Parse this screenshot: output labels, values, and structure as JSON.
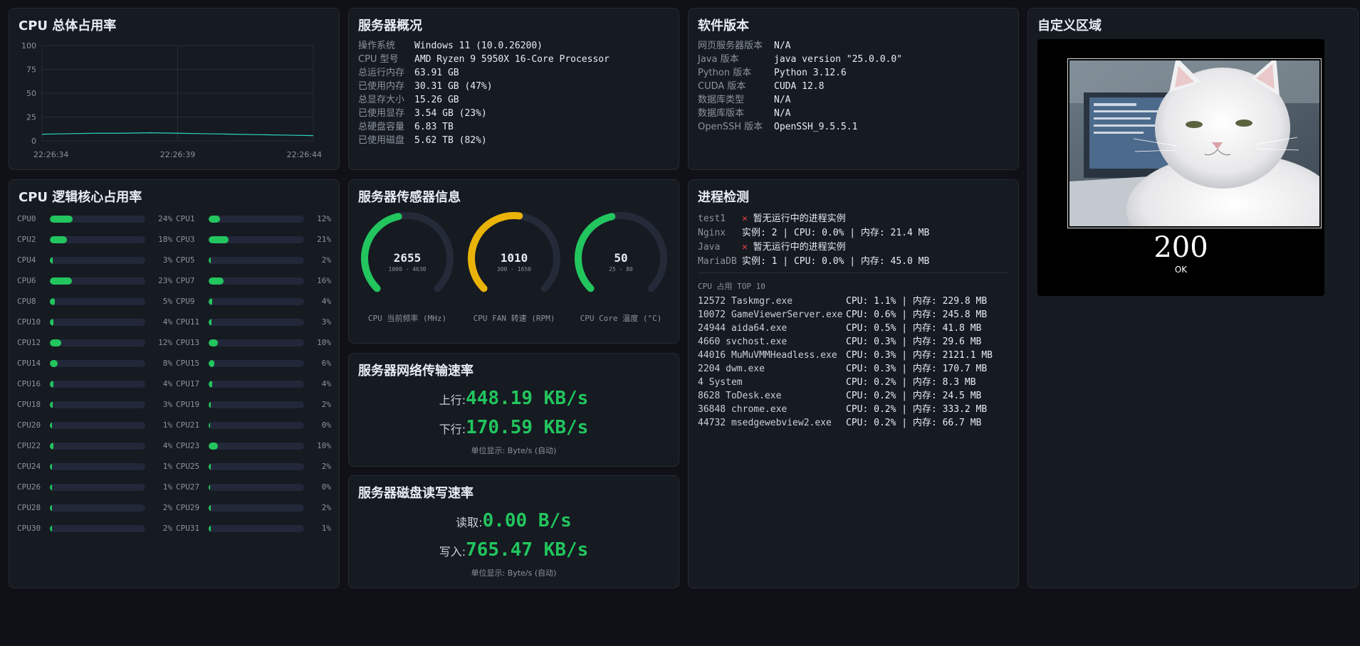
{
  "cpu_total": {
    "title": "CPU 总体占用率",
    "chart_data": {
      "type": "line",
      "title": "",
      "xlabel": "",
      "ylabel": "",
      "ylim": [
        0,
        100
      ],
      "yticks": [
        "100",
        "75",
        "50",
        "25",
        "0"
      ],
      "xticks": [
        "22:26:34",
        "22:26:39",
        "22:26:44"
      ],
      "grid": true,
      "series": [
        {
          "values": [
            7,
            7.5,
            8,
            8,
            8.5,
            8,
            7.5,
            7,
            6.5,
            6,
            5.5
          ]
        }
      ],
      "line_color": "#2dd4bf"
    }
  },
  "overview": {
    "title": "服务器概况",
    "rows": [
      {
        "k": "操作系统",
        "v": "Windows 11 (10.0.26200)"
      },
      {
        "k": "CPU 型号",
        "v": "AMD Ryzen 9 5950X 16-Core Processor"
      },
      {
        "k": "总运行内存",
        "v": "63.91 GB"
      },
      {
        "k": "已使用内存",
        "v": "30.31 GB (47%)"
      },
      {
        "k": "总显存大小",
        "v": "15.26 GB"
      },
      {
        "k": "已使用显存",
        "v": "3.54 GB (23%)"
      },
      {
        "k": "总硬盘容量",
        "v": "6.83 TB"
      },
      {
        "k": "已使用磁盘",
        "v": "5.62 TB (82%)"
      }
    ]
  },
  "software": {
    "title": "软件版本",
    "rows": [
      {
        "k": "网页服务器版本",
        "v": "N/A"
      },
      {
        "k": "Java 版本",
        "v": "java version \"25.0.0.0\""
      },
      {
        "k": "Python 版本",
        "v": "Python 3.12.6"
      },
      {
        "k": "CUDA 版本",
        "v": "CUDA 12.8"
      },
      {
        "k": "数据库类型",
        "v": "N/A"
      },
      {
        "k": "数据库版本",
        "v": "N/A"
      },
      {
        "k": "OpenSSH 版本",
        "v": "OpenSSH_9.5.5.1"
      }
    ]
  },
  "custom": {
    "title": "自定义区域",
    "image_alt": "white-cat-image",
    "code": "200",
    "status": "OK"
  },
  "cores": {
    "title": "CPU 逻辑核心占用率",
    "items": [
      {
        "name": "CPU0",
        "pct": 24
      },
      {
        "name": "CPU1",
        "pct": 12
      },
      {
        "name": "CPU2",
        "pct": 18
      },
      {
        "name": "CPU3",
        "pct": 21
      },
      {
        "name": "CPU4",
        "pct": 3
      },
      {
        "name": "CPU5",
        "pct": 2
      },
      {
        "name": "CPU6",
        "pct": 23
      },
      {
        "name": "CPU7",
        "pct": 16
      },
      {
        "name": "CPU8",
        "pct": 5
      },
      {
        "name": "CPU9",
        "pct": 4
      },
      {
        "name": "CPU10",
        "pct": 4
      },
      {
        "name": "CPU11",
        "pct": 3
      },
      {
        "name": "CPU12",
        "pct": 12
      },
      {
        "name": "CPU13",
        "pct": 10
      },
      {
        "name": "CPU14",
        "pct": 8
      },
      {
        "name": "CPU15",
        "pct": 6
      },
      {
        "name": "CPU16",
        "pct": 4
      },
      {
        "name": "CPU17",
        "pct": 4
      },
      {
        "name": "CPU18",
        "pct": 3
      },
      {
        "name": "CPU19",
        "pct": 2
      },
      {
        "name": "CPU20",
        "pct": 1
      },
      {
        "name": "CPU21",
        "pct": 0
      },
      {
        "name": "CPU22",
        "pct": 4
      },
      {
        "name": "CPU23",
        "pct": 10
      },
      {
        "name": "CPU24",
        "pct": 1
      },
      {
        "name": "CPU25",
        "pct": 2
      },
      {
        "name": "CPU26",
        "pct": 1
      },
      {
        "name": "CPU27",
        "pct": 0
      },
      {
        "name": "CPU28",
        "pct": 2
      },
      {
        "name": "CPU29",
        "pct": 2
      },
      {
        "name": "CPU30",
        "pct": 2
      },
      {
        "name": "CPU31",
        "pct": 1
      }
    ]
  },
  "sensors": {
    "title": "服务器传感器信息",
    "gauges": [
      {
        "value": "2655",
        "min": 1000,
        "max": 4630,
        "range": "1000 - 4630",
        "label": "CPU 当前频率 (MHz)",
        "color": "#22c55e"
      },
      {
        "value": "1010",
        "min": 300,
        "max": 1650,
        "range": "300 - 1650",
        "label": "CPU FAN 转速 (RPM)",
        "color": "#eab308"
      },
      {
        "value": "50",
        "min": 25,
        "max": 80,
        "range": "25 - 80",
        "label": "CPU Core 温度 (°C)",
        "color": "#22c55e"
      }
    ]
  },
  "network": {
    "title": "服务器网络传输速率",
    "up_label": "上行:",
    "up_value": "448.19 KB/s",
    "down_label": "下行:",
    "down_value": "170.59 KB/s",
    "unit_note": "单位显示: Byte/s (自动)"
  },
  "disk": {
    "title": "服务器磁盘读写速率",
    "read_label": "读取:",
    "read_value": "0.00 B/s",
    "write_label": "写入:",
    "write_value": "765.47 KB/s",
    "unit_note": "单位显示: Byte/s (自动)"
  },
  "process": {
    "title": "进程检测",
    "items": [
      {
        "name": "test1",
        "running": false,
        "text": "暂无运行中的进程实例"
      },
      {
        "name": "Nginx",
        "running": true,
        "text": "实例: 2 | CPU: 0.0% | 内存: 21.4 MB"
      },
      {
        "name": "Java",
        "running": false,
        "text": "暂无运行中的进程实例"
      },
      {
        "name": "MariaDB",
        "running": true,
        "text": "实例: 1 | CPU: 0.0% | 内存: 45.0 MB"
      }
    ],
    "top_title": "CPU 占用 TOP 10",
    "top": [
      {
        "proc": "12572 Taskmgr.exe",
        "cpu": "CPU: 1.1% | 内存: 229.8 MB"
      },
      {
        "proc": "10072 GameViewerServer.exe",
        "cpu": "CPU: 0.6% | 内存: 245.8 MB"
      },
      {
        "proc": "24944 aida64.exe",
        "cpu": "CPU: 0.5% | 内存: 41.8 MB"
      },
      {
        "proc": "4660 svchost.exe",
        "cpu": "CPU: 0.3% | 内存: 29.6 MB"
      },
      {
        "proc": "44016 MuMuVMMHeadless.exe",
        "cpu": "CPU: 0.3% | 内存: 2121.1 MB"
      },
      {
        "proc": "2204 dwm.exe",
        "cpu": "CPU: 0.3% | 内存: 170.7 MB"
      },
      {
        "proc": "4 System",
        "cpu": "CPU: 0.2% | 内存: 8.3 MB"
      },
      {
        "proc": "8628 ToDesk.exe",
        "cpu": "CPU: 0.2% | 内存: 24.5 MB"
      },
      {
        "proc": "36848 chrome.exe",
        "cpu": "CPU: 0.2% | 内存: 333.2 MB"
      },
      {
        "proc": "44732 msedgewebview2.exe",
        "cpu": "CPU: 0.2% | 内存: 66.7 MB"
      }
    ]
  }
}
